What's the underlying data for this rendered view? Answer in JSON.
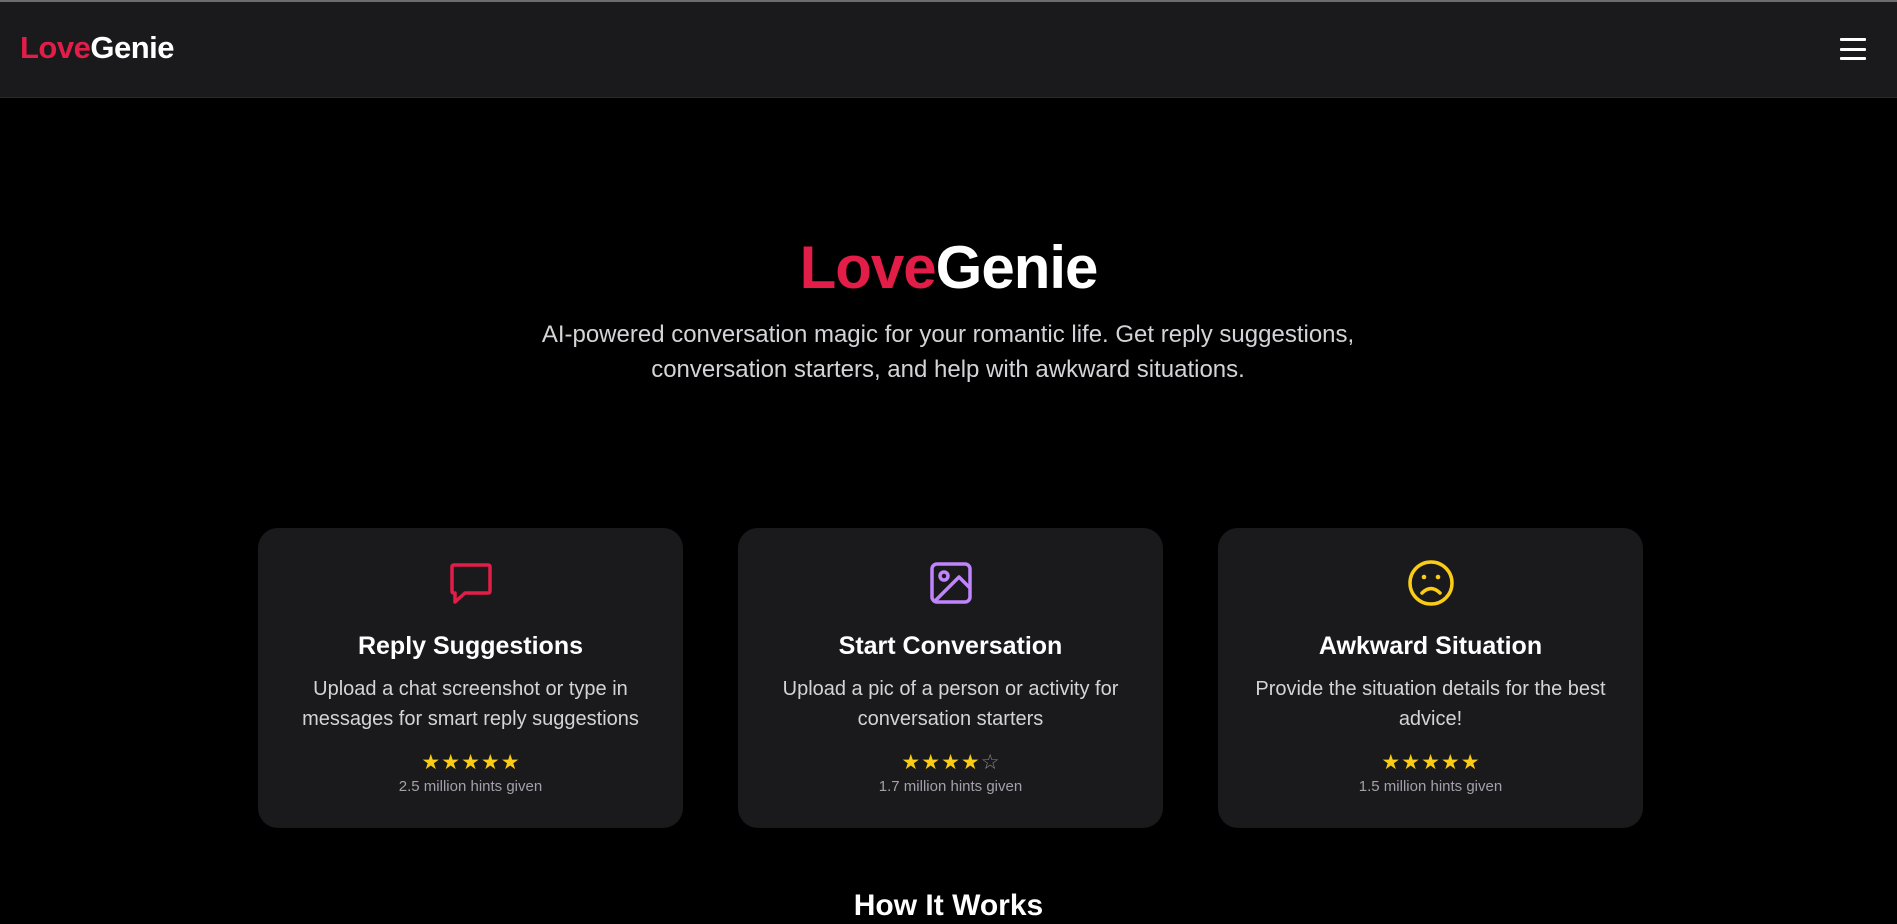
{
  "nav": {
    "logo_part1": "Love",
    "logo_part2": "Genie",
    "menu_icon": "hamburger-menu-icon"
  },
  "hero": {
    "title_part1": "Love",
    "title_part2": "Genie",
    "subtitle": "AI-powered conversation magic for your romantic life. Get reply suggestions, conversation starters, and help with awkward situations."
  },
  "colors": {
    "accent": "#e11d48",
    "purple": "#c084fc",
    "yellow": "#facc15",
    "background": "#000000",
    "card": "#1a1a1c"
  },
  "cards": [
    {
      "icon": "chat-bubble-icon",
      "title": "Reply Suggestions",
      "description": "Upload a chat screenshot or type in messages for smart reply suggestions",
      "rating": 5,
      "rating_max": 5,
      "hints": "2.5 million hints given"
    },
    {
      "icon": "image-icon",
      "title": "Start Conversation",
      "description": "Upload a pic of a person or activity for conversation starters",
      "rating": 4,
      "rating_max": 5,
      "hints": "1.7 million hints given"
    },
    {
      "icon": "sad-face-icon",
      "title": "Awkward Situation",
      "description": "Provide the situation details for the best advice!",
      "rating": 5,
      "rating_max": 5,
      "hints": "1.5 million hints given"
    }
  ],
  "how_it_works": {
    "title": "How It Works"
  }
}
